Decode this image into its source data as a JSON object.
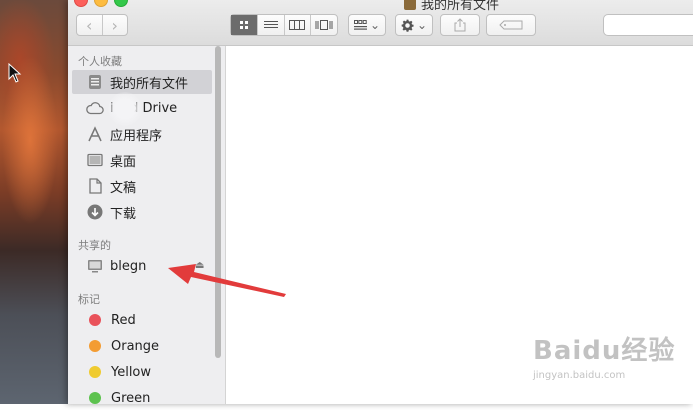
{
  "window": {
    "title": "我的所有文件"
  },
  "toolbar": {
    "back_glyph": "‹",
    "forward_glyph": "›",
    "views": [
      "icon-view",
      "list-view",
      "column-view",
      "coverflow-view"
    ],
    "active_view": "icon-view",
    "caret": "⌄"
  },
  "sidebar": {
    "favorites_header": "个人收藏",
    "favorites": [
      {
        "label": "我的所有文件",
        "icon": "all-files-icon"
      },
      {
        "label": "i    d Drive",
        "icon": "cloud-icon"
      },
      {
        "label": "应用程序",
        "icon": "applications-icon"
      },
      {
        "label": "桌面",
        "icon": "desktop-icon"
      },
      {
        "label": "文稿",
        "icon": "documents-icon"
      },
      {
        "label": "下载",
        "icon": "downloads-icon"
      }
    ],
    "shared_header": "共享的",
    "shared": [
      {
        "label": "blegn",
        "icon": "computer-icon"
      }
    ],
    "eject_glyph": "⏏",
    "tags_header": "标记",
    "tags": [
      {
        "label": "Red",
        "color": "#e9525a"
      },
      {
        "label": "Orange",
        "color": "#f39c33"
      },
      {
        "label": "Yellow",
        "color": "#efcb30"
      },
      {
        "label": "Green",
        "color": "#5dc24f"
      }
    ]
  },
  "colors": {
    "annotation_arrow": "#e23b3b",
    "selected_row": "#d2d2d6"
  },
  "watermark": {
    "logo": "Baidu经验",
    "url": "jingyan.baidu.com"
  }
}
